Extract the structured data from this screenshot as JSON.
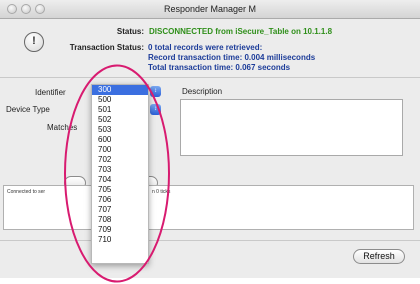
{
  "window": {
    "title": "Responder Manager M"
  },
  "status": {
    "status_label": "Status:",
    "status_value": "DISCONNECTED from iSecure_Table on 10.1.1.8",
    "status_color": "#2f8f1a",
    "transaction_label": "Transaction Status:",
    "transaction_lines": [
      "0 total records were retrieved:",
      "Record transaction time: 0.004 milliseconds",
      "Total transaction time: 0.067 seconds"
    ],
    "transaction_color": "#1c3c99"
  },
  "form": {
    "identifier_label": "Identifier",
    "device_type_label": "Device Type",
    "matches_label": "Matches",
    "description_label": "Description"
  },
  "dropdown": {
    "options": [
      "300",
      "500",
      "501",
      "502",
      "503",
      "600",
      "700",
      "702",
      "703",
      "704",
      "705",
      "706",
      "707",
      "708",
      "709",
      "710"
    ],
    "selected": "300",
    "selected_color": "#3b6fe0"
  },
  "log": {
    "line_start": "Connected to ser",
    "line_end": "n 0 ticks"
  },
  "buttons": {
    "refresh_label": "Refresh"
  },
  "annotation": {
    "ellipse_color": "#d81b70"
  }
}
